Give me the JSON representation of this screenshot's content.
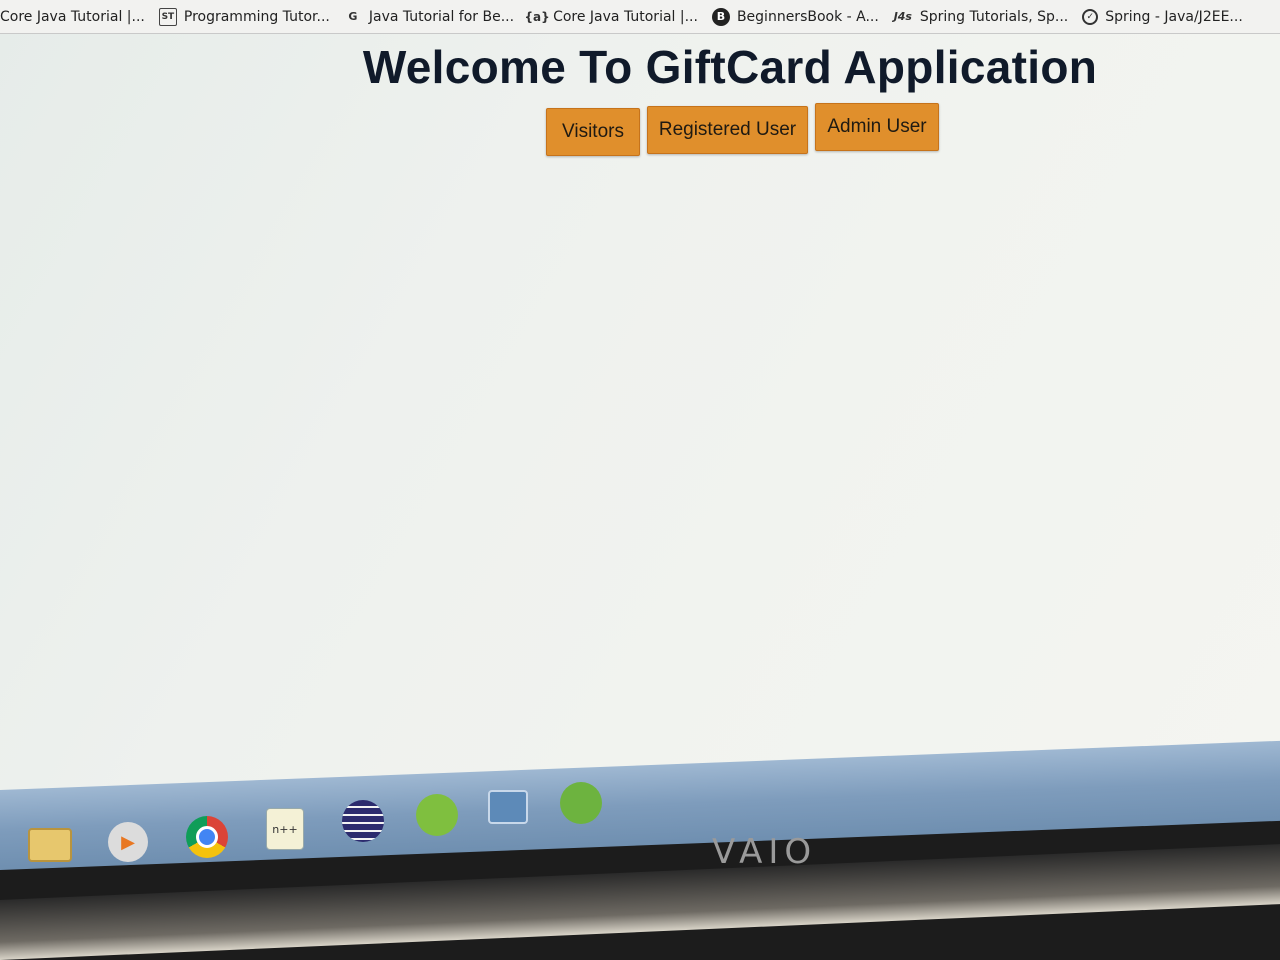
{
  "bookmarks": [
    {
      "label": "Core Java Tutorial |...",
      "icon": "none"
    },
    {
      "label": "Programming Tutor...",
      "icon": "tutorial-book-icon"
    },
    {
      "label": "Java Tutorial for Be...",
      "icon": "g-logo-icon"
    },
    {
      "label": "Core Java Tutorial |...",
      "icon": "bracket-logo-icon"
    },
    {
      "label": "BeginnersBook - A...",
      "icon": "b-circle-icon"
    },
    {
      "label": "Spring Tutorials, Sp...",
      "icon": "j4s-icon"
    },
    {
      "label": "Spring - Java/J2EE...",
      "icon": "spring-leaf-icon"
    }
  ],
  "page": {
    "title": "Welcome To GiftCard Application",
    "buttons": [
      "Visitors",
      "Registered User",
      "Admin User"
    ],
    "button_color": "#e08f2c"
  },
  "hardware": {
    "logo": "VAIO"
  },
  "taskbar": {
    "icons": [
      "folder-icon",
      "media-player-icon",
      "chrome-icon",
      "notepad-icon",
      "eclipse-icon",
      "spring-tool-icon",
      "window-icon",
      "spring-leaf-icon"
    ]
  }
}
